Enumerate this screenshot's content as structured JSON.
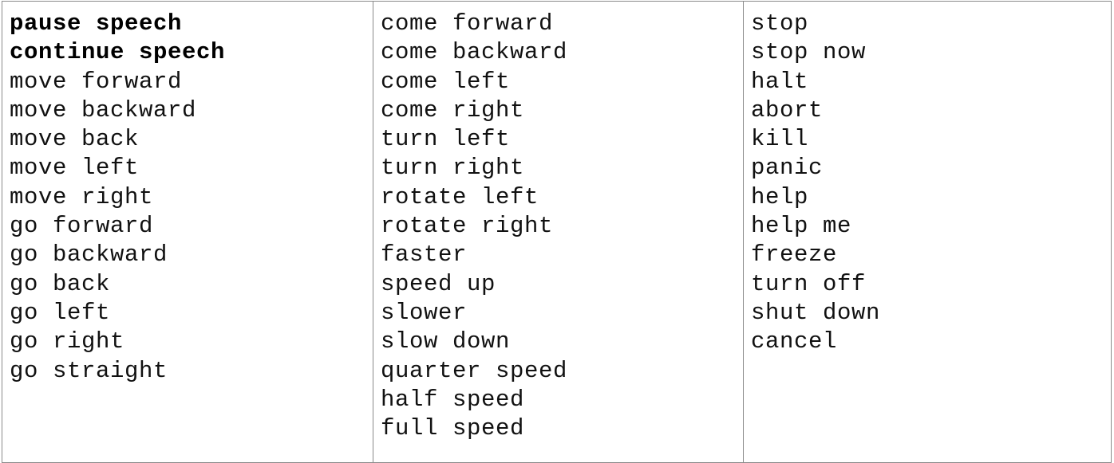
{
  "columns": [
    {
      "items": [
        {
          "text": "pause speech",
          "bold": true
        },
        {
          "text": "continue speech",
          "bold": true
        },
        {
          "text": "move forward",
          "bold": false
        },
        {
          "text": "move backward",
          "bold": false
        },
        {
          "text": "move back",
          "bold": false
        },
        {
          "text": "move left",
          "bold": false
        },
        {
          "text": "move right",
          "bold": false
        },
        {
          "text": "go forward",
          "bold": false
        },
        {
          "text": "go backward",
          "bold": false
        },
        {
          "text": "go back",
          "bold": false
        },
        {
          "text": "go left",
          "bold": false
        },
        {
          "text": "go right",
          "bold": false
        },
        {
          "text": "go straight",
          "bold": false
        }
      ]
    },
    {
      "items": [
        {
          "text": "come forward",
          "bold": false
        },
        {
          "text": "come backward",
          "bold": false
        },
        {
          "text": "come left",
          "bold": false
        },
        {
          "text": "come right",
          "bold": false
        },
        {
          "text": "turn left",
          "bold": false
        },
        {
          "text": "turn right",
          "bold": false
        },
        {
          "text": "rotate left",
          "bold": false
        },
        {
          "text": "rotate right",
          "bold": false
        },
        {
          "text": "faster",
          "bold": false
        },
        {
          "text": "speed up",
          "bold": false
        },
        {
          "text": "slower",
          "bold": false
        },
        {
          "text": "slow down",
          "bold": false
        },
        {
          "text": "quarter speed",
          "bold": false
        },
        {
          "text": "half speed",
          "bold": false
        },
        {
          "text": "full speed",
          "bold": false
        }
      ]
    },
    {
      "items": [
        {
          "text": "stop",
          "bold": false
        },
        {
          "text": "stop now",
          "bold": false
        },
        {
          "text": "halt",
          "bold": false
        },
        {
          "text": "abort",
          "bold": false
        },
        {
          "text": "kill",
          "bold": false
        },
        {
          "text": "panic",
          "bold": false
        },
        {
          "text": "help",
          "bold": false
        },
        {
          "text": "help me",
          "bold": false
        },
        {
          "text": "freeze",
          "bold": false
        },
        {
          "text": "turn off",
          "bold": false
        },
        {
          "text": "shut down",
          "bold": false
        },
        {
          "text": "cancel",
          "bold": false
        }
      ]
    }
  ]
}
